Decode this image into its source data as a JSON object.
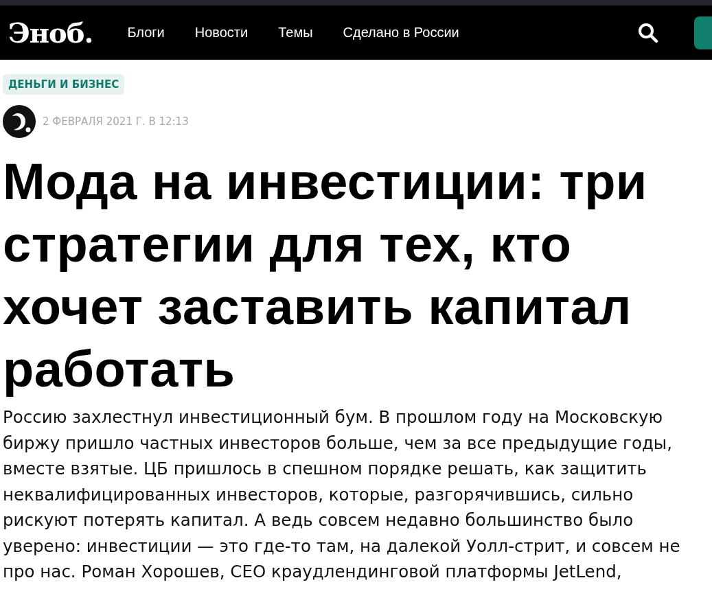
{
  "header": {
    "logo": "Эноб.",
    "nav": [
      {
        "label": "Блоги"
      },
      {
        "label": "Новости"
      },
      {
        "label": "Темы"
      },
      {
        "label": "Сделано в России"
      }
    ]
  },
  "article": {
    "rubric": "ДЕНЬГИ И БИЗНЕС",
    "date": "2 ФЕВРАЛЯ 2021 Г. В 12:13",
    "title": "Мода на инвестиции: три стратегии для тех, кто хочет заставить капитал работать",
    "lead": "Россию захлестнул инвестиционный бум. В прошлом году на Московскую биржу пришло частных инвесторов больше, чем за все предыдущие годы, вместе взятые. ЦБ пришлось в спешном порядке решать, как защитить неквалифицированных инвесторов, которые, разгорячившись, сильно рискуют потерять капитал. А ведь совсем недавно большинство было уверено: инвестиции — это где-то там, на далекой Уолл-стрит, и совсем не про нас. Роман Хорошев, CEO краудлендинговой платформы JetLend,"
  }
}
